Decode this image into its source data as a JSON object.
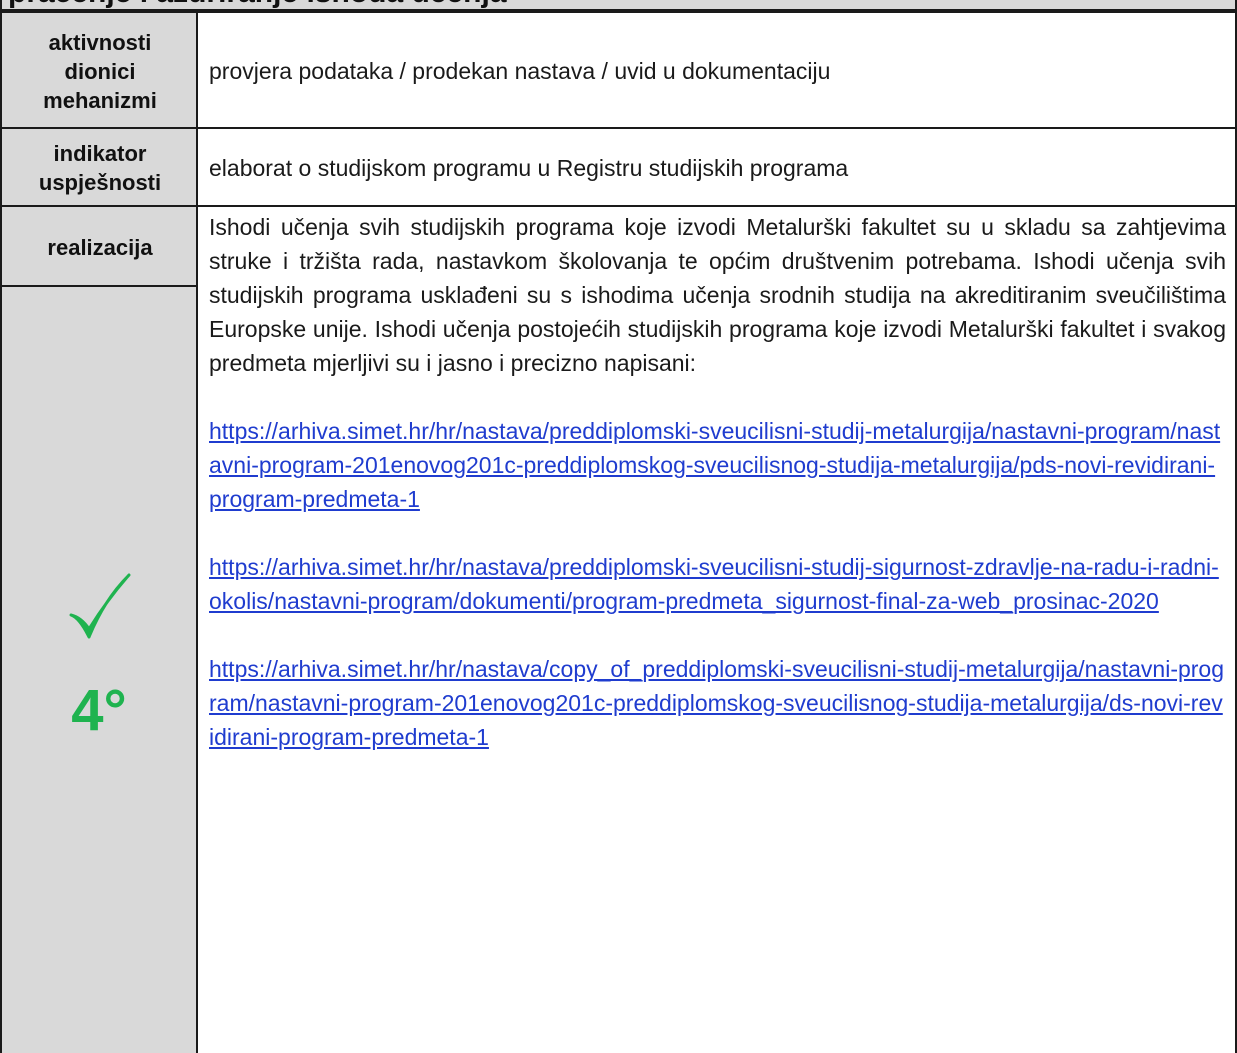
{
  "banner": {
    "title": "praćenje i ažuriranje ishoda učenja"
  },
  "rows": {
    "activities": {
      "labels": [
        "aktivnosti",
        "dionici",
        "mehanizmi"
      ],
      "value": "provjera podataka / prodekan nastava / uvid u dokumentaciju"
    },
    "indicator": {
      "labels": [
        "indikator",
        "uspješnosti"
      ],
      "value": "elaborat o studijskom programu u Registru studijskih programa"
    },
    "realization": {
      "label": "realizacija",
      "paragraph": "Ishodi učenja svih studijskih programa koje izvodi Metalurški fakultet su u skladu sa zahtjevima struke i tržišta rada, nastavkom školovanja te općim društvenim potrebama. Ishodi učenja svih studijskih programa usklađeni su s ishodima učenja srodnih studija na akreditiranim sveučilištima Europske unije. Ishodi učenja postojećih studijskih programa koje izvodi Metalurški fakultet i svakog predmeta mjerljivi su i jasno i precizno napisani:",
      "links": [
        "https://arhiva.simet.hr/hr/nastava/preddiplomski-sveucilisni-studij-metalurgija/nastavni-program/nastavni-program-201enovog201c-preddiplomskog-sveucilisnog-studija-metalurgija/pds-novi-revidirani-program-predmeta-1",
        "https://arhiva.simet.hr/hr/nastava/preddiplomski-sveucilisni-studij-sigurnost-zdravlje-na-radu-i-radni-okolis/nastavni-program/dokumenti/program-predmeta_sigurnost-final-za-web_prosinac-2020",
        "https://arhiva.simet.hr/hr/nastava/copy_of_preddiplomski-sveucilisni-studij-metalurgija/nastavni-program/nastavni-program-201enovog201c-preddiplomskog-sveucilisnog-studija-metalurgija/ds-novi-revidirani-program-predmeta-1"
      ]
    }
  },
  "status": {
    "icon": "checkmark-icon",
    "level": "4°",
    "color": "#1fb34f"
  },
  "colors": {
    "header_bg": "#d9d9d9",
    "link": "#1f3ccf",
    "border": "#1a1a1a"
  }
}
